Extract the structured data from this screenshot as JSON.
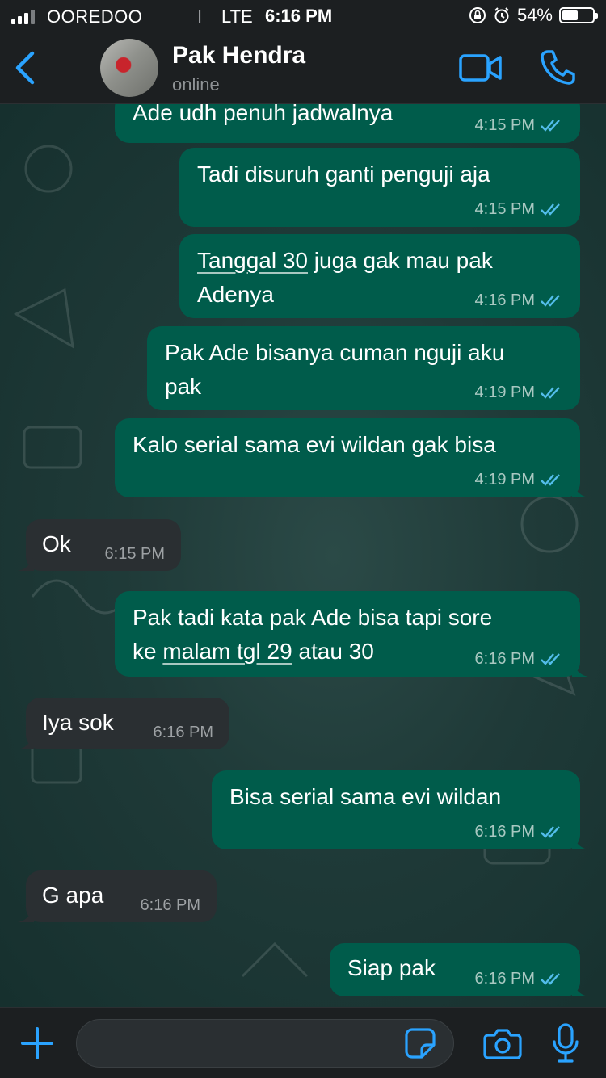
{
  "status_bar": {
    "carrier": "OOREDOO",
    "network_glyph": "I",
    "network": "LTE",
    "time": "6:16 PM",
    "battery": "54%",
    "battery_level": 0.54
  },
  "header": {
    "contact_name": "Pak Hendra",
    "contact_status": "online"
  },
  "colors": {
    "accent": "#2aa3ff",
    "outgoing_bubble": "#005c4b",
    "incoming_bubble": "#2a2f32",
    "read_ticks": "#53bdeb"
  },
  "messages": [
    {
      "dir": "out",
      "lines": [
        "Ade udh penuh jadwalnya"
      ],
      "time": "4:15 PM"
    },
    {
      "dir": "out",
      "lines": [
        "Tadi disuruh ganti penguji aja"
      ],
      "time": "4:15 PM"
    },
    {
      "dir": "out",
      "lines": [
        "Tanggal 30 juga gak mau pak",
        "Adenya"
      ],
      "time": "4:16 PM"
    },
    {
      "dir": "out",
      "lines": [
        "Pak Ade bisanya cuman nguji aku",
        "pak"
      ],
      "time": "4:19 PM"
    },
    {
      "dir": "out",
      "lines": [
        "Kalo serial sama evi wildan gak bisa"
      ],
      "time": "4:19 PM"
    },
    {
      "dir": "in",
      "lines": [
        "Ok"
      ],
      "time": "6:15 PM"
    },
    {
      "dir": "out",
      "lines": [
        "Pak tadi kata pak Ade bisa tapi sore",
        "ke malam tgl 29 atau 30"
      ],
      "time": "6:16 PM"
    },
    {
      "dir": "in",
      "lines": [
        "Iya sok"
      ],
      "time": "6:16 PM"
    },
    {
      "dir": "out",
      "lines": [
        "Bisa serial sama evi wildan"
      ],
      "time": "6:16 PM"
    },
    {
      "dir": "in",
      "lines": [
        "G apa"
      ],
      "time": "6:16 PM"
    },
    {
      "dir": "out",
      "lines": [
        "Siap pak"
      ],
      "time": "6:16 PM"
    }
  ],
  "icons": {
    "back": "chevron-left-icon",
    "video": "video-camera-icon",
    "call": "phone-icon",
    "plus": "plus-icon",
    "sticker": "sticker-icon",
    "camera": "camera-icon",
    "mic": "microphone-icon"
  }
}
